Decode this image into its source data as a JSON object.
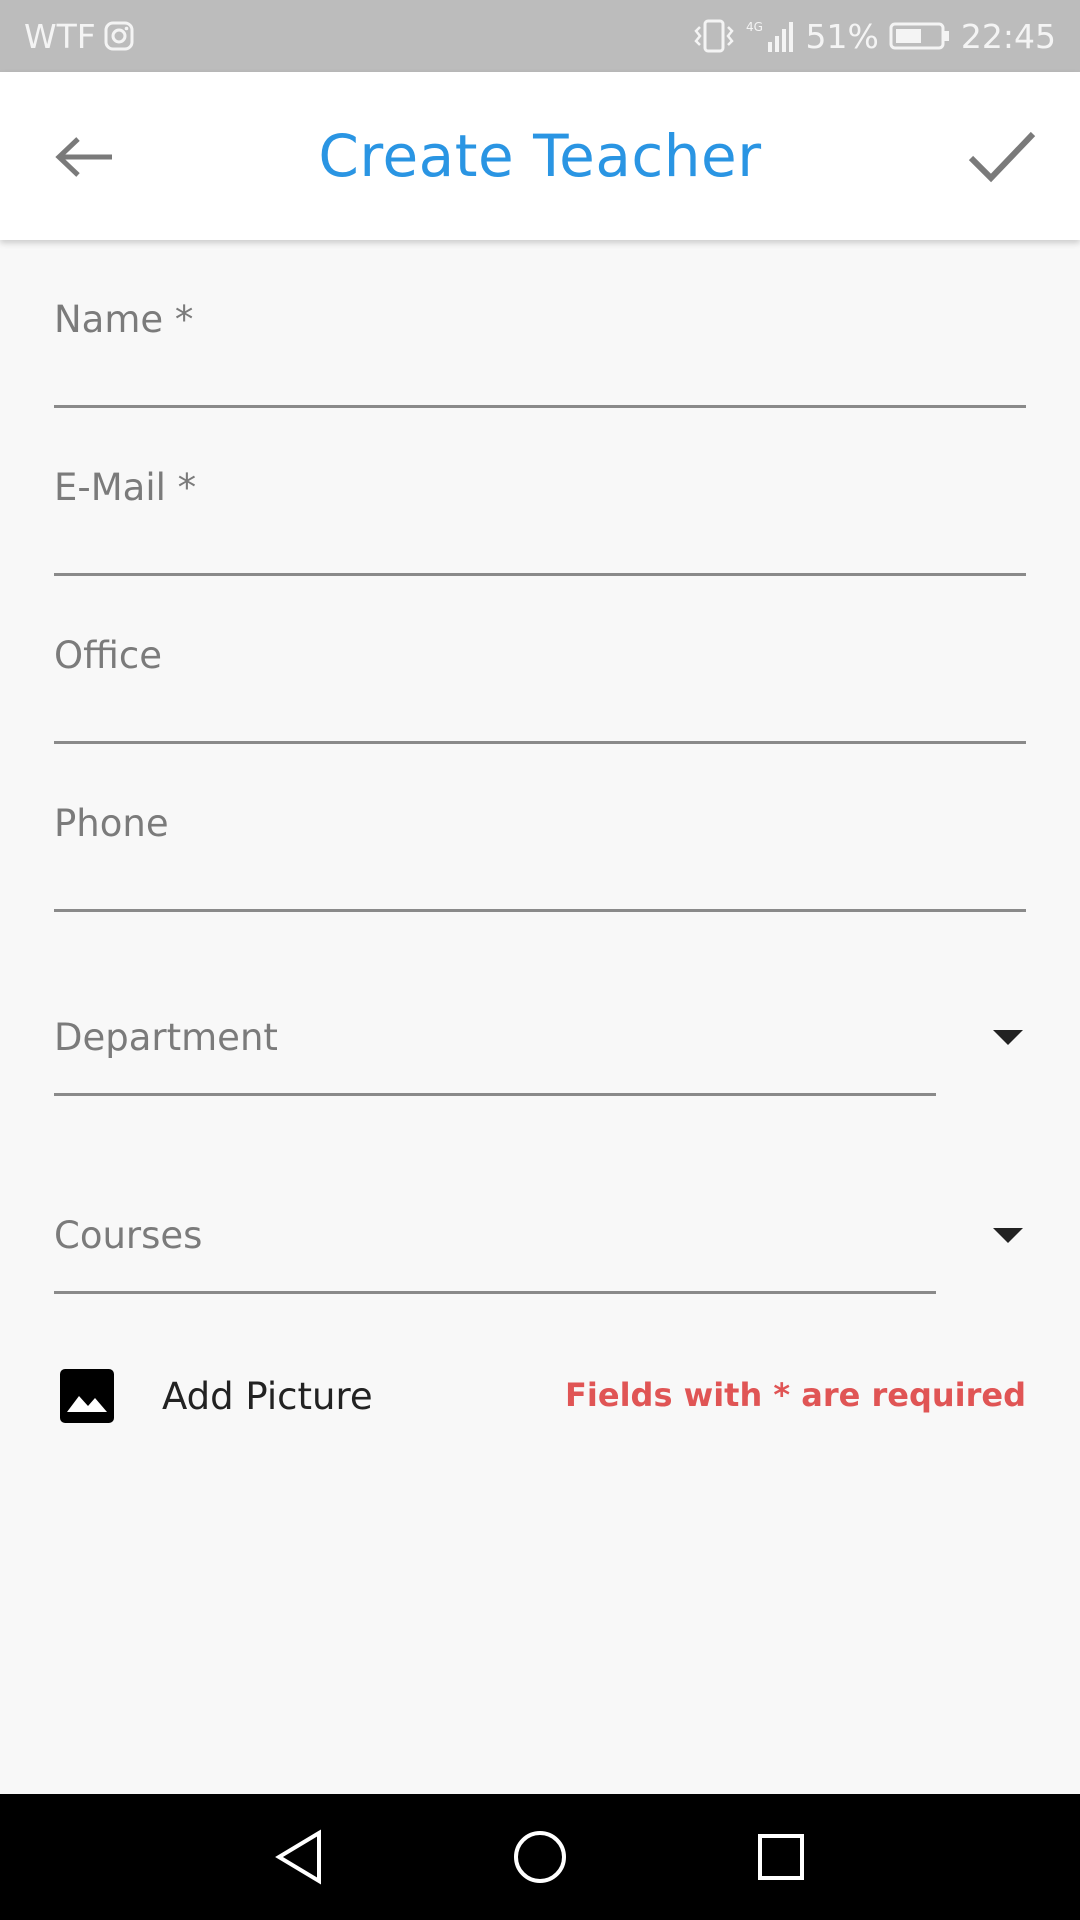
{
  "status_bar": {
    "carrier": "WTF",
    "network": "4G",
    "battery": "51%",
    "time": "22:45",
    "icons": [
      "instagram-icon",
      "vibrate-icon",
      "signal-icon",
      "battery-icon"
    ]
  },
  "app_bar": {
    "title": "Create Teacher",
    "back_icon": "arrow-left-icon",
    "confirm_icon": "check-icon",
    "title_color": "#2a95e3"
  },
  "form": {
    "name": {
      "placeholder": "Name *",
      "value": ""
    },
    "email": {
      "placeholder": "E-Mail *",
      "value": ""
    },
    "office": {
      "placeholder": "Office",
      "value": ""
    },
    "phone": {
      "placeholder": "Phone",
      "value": ""
    },
    "department": {
      "placeholder": "Department",
      "selected": ""
    },
    "courses": {
      "placeholder": "Courses",
      "selected": ""
    }
  },
  "add_picture": {
    "label": "Add Picture",
    "icon": "image-icon"
  },
  "required_note": {
    "text": "Fields with * are required",
    "color": "#e05555"
  },
  "nav_bar": {
    "icons": [
      "back-triangle-icon",
      "home-circle-icon",
      "recents-square-icon"
    ]
  }
}
